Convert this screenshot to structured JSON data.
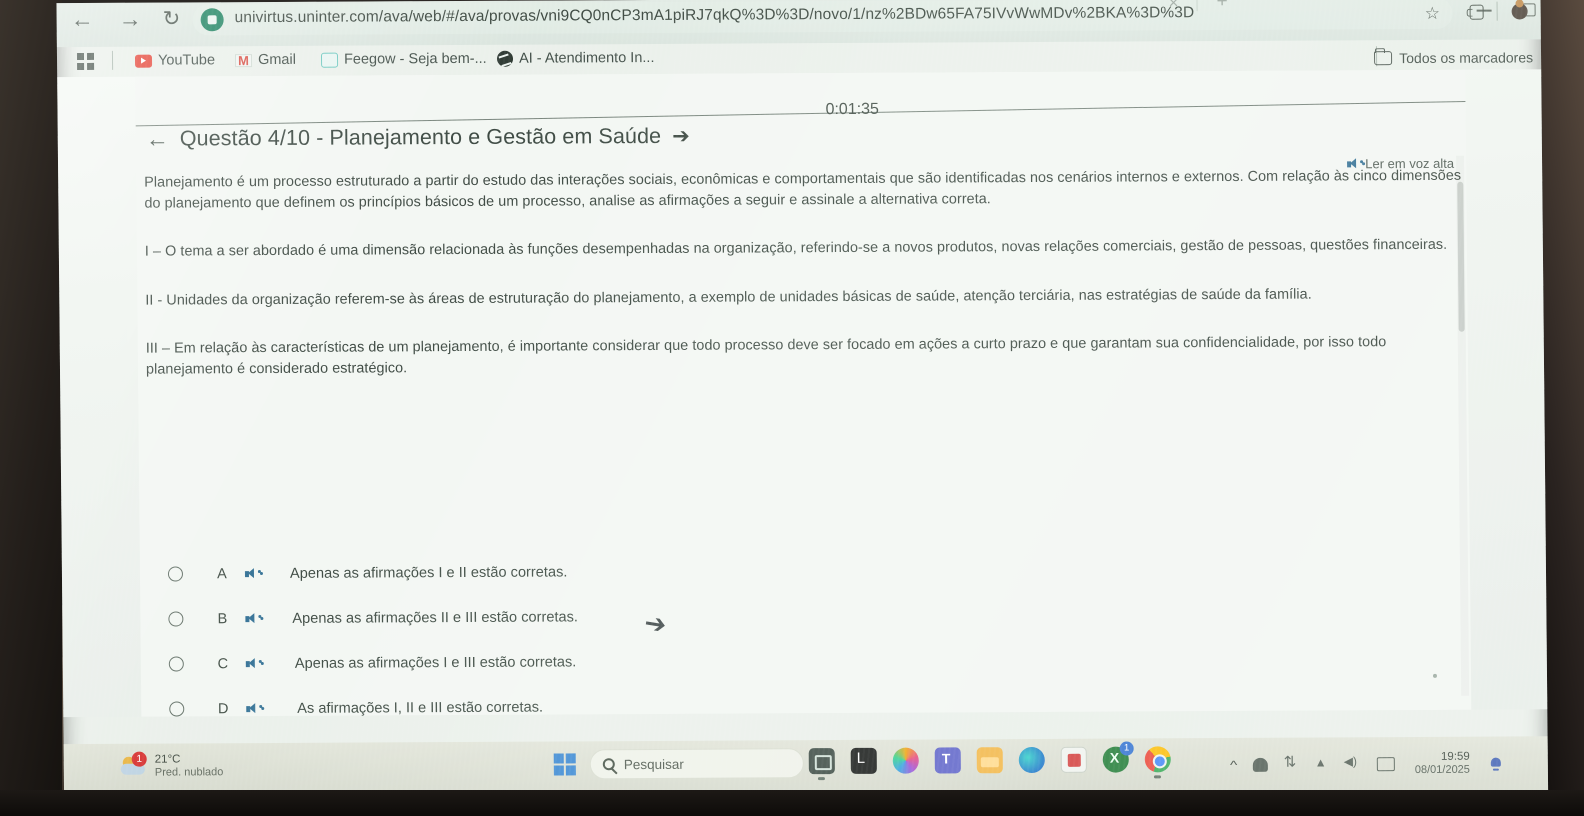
{
  "browser": {
    "back_icon": "back-arrow-icon",
    "forward_icon": "forward-arrow-icon",
    "reload_icon": "reload-icon",
    "url": "univirtus.uninter.com/ava/web/#/ava/provas/vni9CQ0nCP3mA1piRJ7qkQ%3D%3D/novo/1/nz%2BDw65FA75IVvWwMDv%2BKA%3D%3D",
    "new_tab_label": "+",
    "close_tab_label": "×",
    "bookmarks": [
      {
        "label": "YouTube",
        "icon": "youtube-icon"
      },
      {
        "label": "Gmail",
        "icon": "gmail-icon"
      },
      {
        "label": "Feegow - Seja bem-...",
        "icon": "feegow-icon"
      },
      {
        "label": "AI - Atendimento In...",
        "icon": "ai-atendimento-icon"
      }
    ],
    "all_bookmarks_label": "Todos os marcadores"
  },
  "quiz": {
    "back_arrow": "←",
    "forward_arrow": "➔",
    "title": "Questão 4/10 - Planejamento e Gestão em Saúde",
    "timer": "0:01:35",
    "tts_label": "Ler em voz alta",
    "statement_intro": "Planejamento é um processo estruturado a partir do estudo das interações sociais, econômicas e comportamentais que são identificadas nos cenários internos e externos. Com relação às cinco dimensões do planejamento que definem os princípios básicos de um processo, analise as afirmações a seguir e assinale a alternativa correta.",
    "statement_i": "I – O tema a ser abordado é uma dimensão relacionada às funções desempenhadas na organização, referindo-se a novos produtos, novas relações comerciais, gestão de pessoas, questões financeiras.",
    "statement_ii": "II - Unidades da organização referem-se às áreas de estruturação do planejamento, a exemplo de unidades básicas de saúde, atenção terciária, nas estratégias de saúde da família.",
    "statement_iii": "III – Em relação às características de um planejamento, é importante considerar que todo processo deve ser focado em ações a curto prazo e que garantam sua confidencialidade, por isso todo planejamento é considerado estratégico.",
    "options": [
      {
        "letter": "A",
        "text": "Apenas as afirmações I e II estão corretas.",
        "selected": false
      },
      {
        "letter": "B",
        "text": "Apenas as afirmações II e III estão corretas.",
        "selected": false
      },
      {
        "letter": "C",
        "text": "Apenas as afirmações I e III estão corretas.",
        "selected": false
      },
      {
        "letter": "D",
        "text": "As afirmações I, II e III estão corretas.",
        "selected": false
      }
    ]
  },
  "taskbar": {
    "weather_temp": "21°C",
    "weather_desc": "Pred. nublado",
    "weather_badge": "1",
    "search_placeholder": "Pesquisar",
    "apps": [
      {
        "name": "snipping-tool"
      },
      {
        "name": "terminal"
      },
      {
        "name": "copilot"
      },
      {
        "name": "teams"
      },
      {
        "name": "file-explorer"
      },
      {
        "name": "edge"
      },
      {
        "name": "store"
      },
      {
        "name": "xbox",
        "badge": "1"
      },
      {
        "name": "chrome"
      }
    ],
    "clock_time": "19:59",
    "clock_date": "08/01/2025"
  },
  "colors": {
    "accent_blue": "#2a6a90",
    "page_bg": "#f2f6f2",
    "taskbar_bg": "#d7dbcf"
  }
}
